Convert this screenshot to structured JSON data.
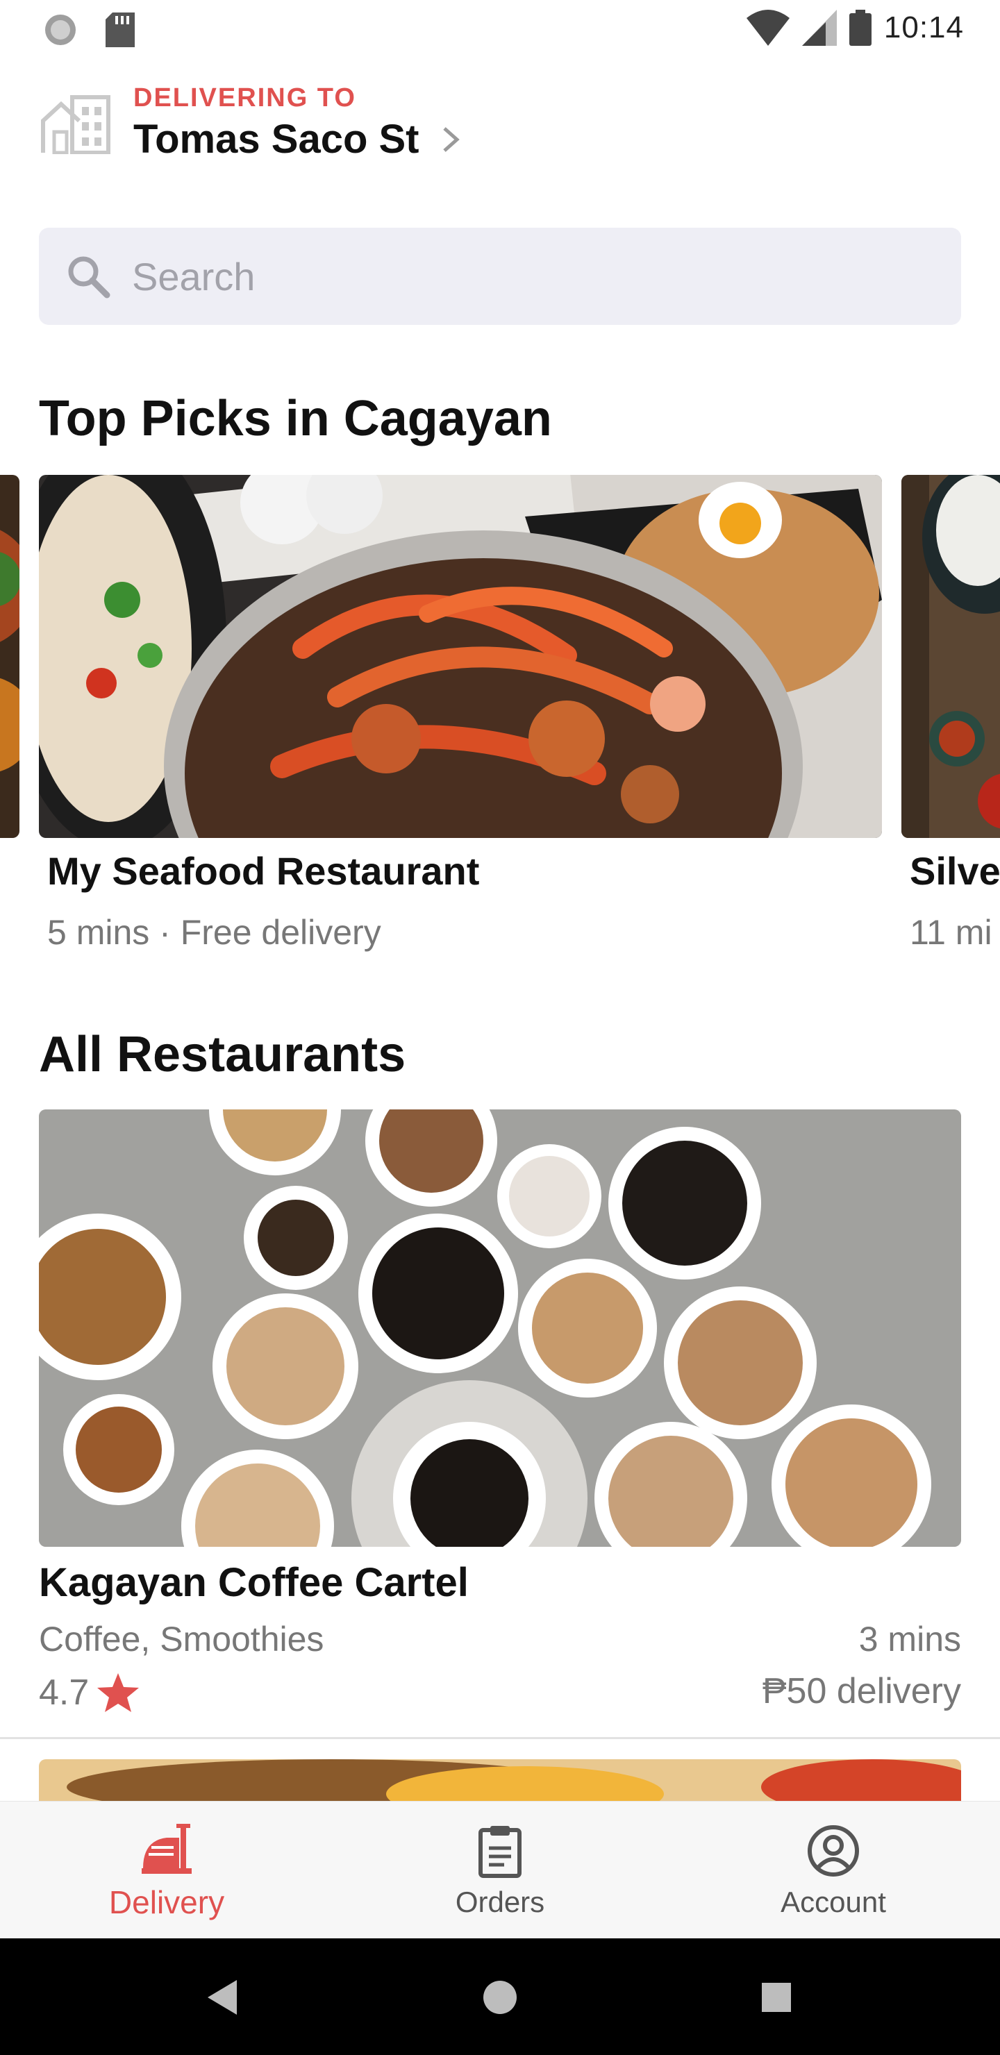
{
  "status_bar": {
    "time": "10:14"
  },
  "location": {
    "eyebrow": "DELIVERING TO",
    "street": "Tomas Saco St"
  },
  "search": {
    "placeholder": "Search"
  },
  "top_picks": {
    "title": "Top Picks in Cagayan",
    "cards": [
      {
        "name": "My Seafood Restaurant",
        "meta": "5 mins · Free delivery"
      },
      {
        "name": "Silve",
        "meta": "11 mi"
      }
    ]
  },
  "all_restaurants": {
    "title": "All Restaurants",
    "items": [
      {
        "name": "Kagayan Coffee Cartel",
        "cuisine": "Coffee, Smoothies",
        "time": "3 mins",
        "rating": "4.7",
        "delivery_fee": "₱50 delivery"
      }
    ]
  },
  "bottom_nav": {
    "items": [
      {
        "label": "Delivery",
        "icon": "delivery-icon",
        "active": true
      },
      {
        "label": "Orders",
        "icon": "clipboard-icon",
        "active": false
      },
      {
        "label": "Account",
        "icon": "account-icon",
        "active": false
      }
    ]
  },
  "colors": {
    "accent": "#e0514f",
    "search_bg": "#eeeef5",
    "muted_text": "#777777"
  }
}
